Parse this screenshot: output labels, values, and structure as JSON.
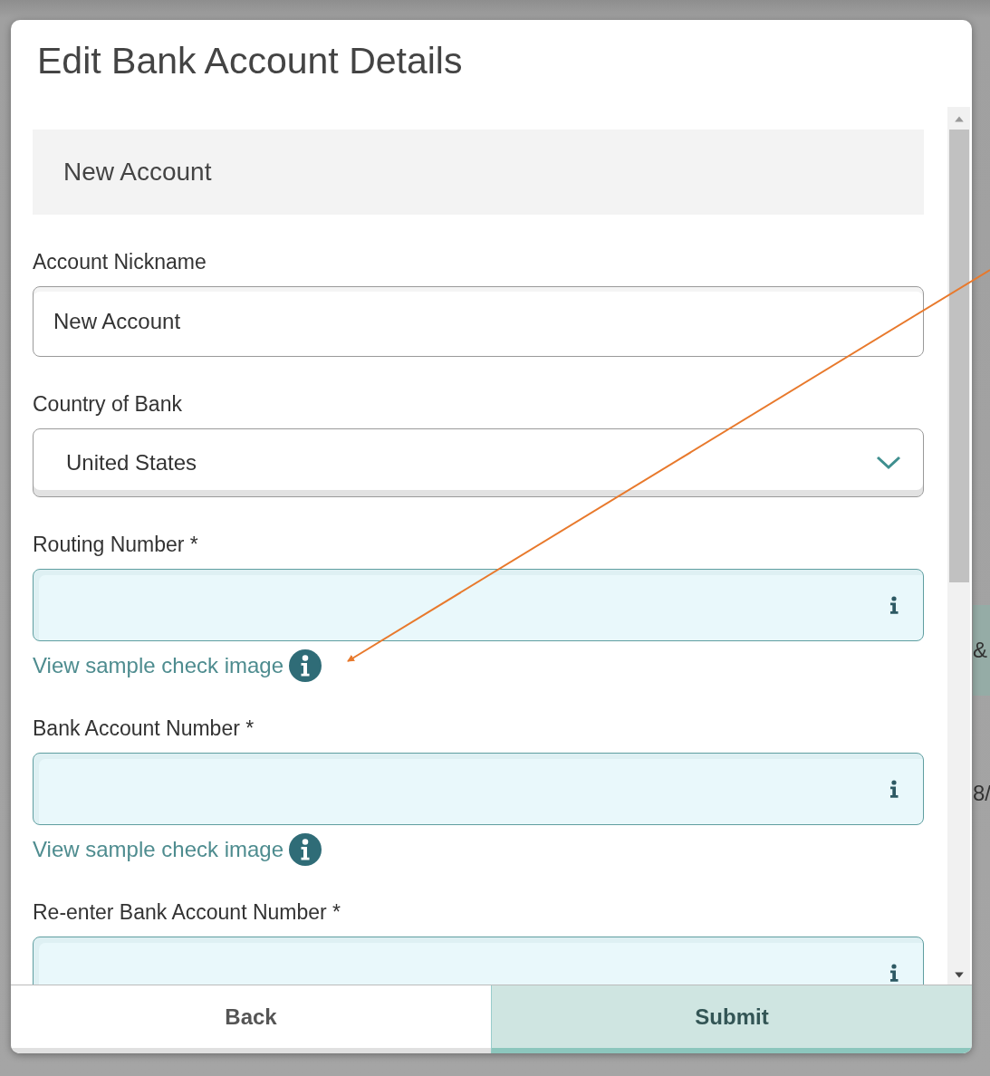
{
  "background": {
    "texts": [
      {
        "text": "&",
        "kind": "band"
      },
      {
        "text": "8/",
        "kind": "plain"
      }
    ]
  },
  "dialog": {
    "title": "Edit Bank Account Details",
    "section_heading": "New Account",
    "fields": [
      {
        "kind": "text",
        "label": "Account Nickname",
        "value": "New Account"
      },
      {
        "kind": "select",
        "label": "Country of Bank",
        "value": "United States"
      },
      {
        "kind": "info",
        "label": "Routing Number *",
        "link": "View sample check image"
      },
      {
        "kind": "info",
        "label": "Bank Account Number *",
        "link": "View sample check image"
      },
      {
        "kind": "info",
        "label": "Re-enter Bank Account Number *"
      }
    ],
    "buttons": [
      {
        "label": "Back",
        "primary": false
      },
      {
        "label": "Submit",
        "primary": true
      }
    ]
  }
}
